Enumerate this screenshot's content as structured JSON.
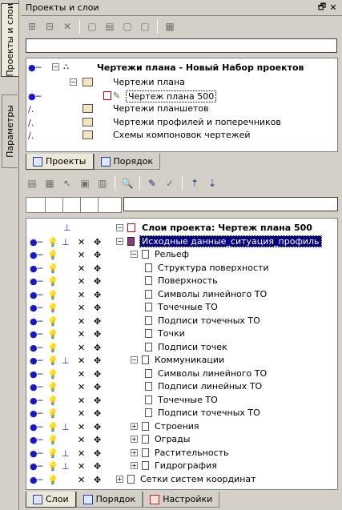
{
  "side_tabs": {
    "projects": "Проекты и слои",
    "params": "Параметры"
  },
  "panel_title": "Проекты и слои",
  "projects_tree": [
    {
      "label": "Чертежи плана - Новый Набор проектов",
      "bold": true
    },
    {
      "label": "Чертежи плана"
    },
    {
      "label": "Чертеж плана 500"
    },
    {
      "label": "Чертежи планшетов"
    },
    {
      "label": "Чертежи профилей и поперечников"
    },
    {
      "label": "Схемы компоновок чертежей"
    }
  ],
  "mid_tabs": {
    "projects": "Проекты",
    "order": "Порядок"
  },
  "layers_root": "Слои проекта: Чертеж плана 500",
  "layers": [
    "Исходные данные_ситуация_профиль",
    "Рельеф",
    "Структура поверхности",
    "Поверхность",
    "Символы линейного ТО",
    "Точечные ТО",
    "Подписи точечных ТО",
    "Точки",
    "Подписи точек",
    "Коммуникации",
    "Символы линейного ТО",
    "Подписи линейных ТО",
    "Точечные ТО",
    "Подписи точечных ТО",
    "Строения",
    "Ограды",
    "Растительность",
    "Гидрография",
    "Сетки систем координат"
  ],
  "bottom_tabs": {
    "layers": "Слои",
    "order": "Порядок",
    "settings": "Настройки"
  },
  "colors": {
    "selection": "#000080",
    "panel": "#d4d0c8"
  }
}
